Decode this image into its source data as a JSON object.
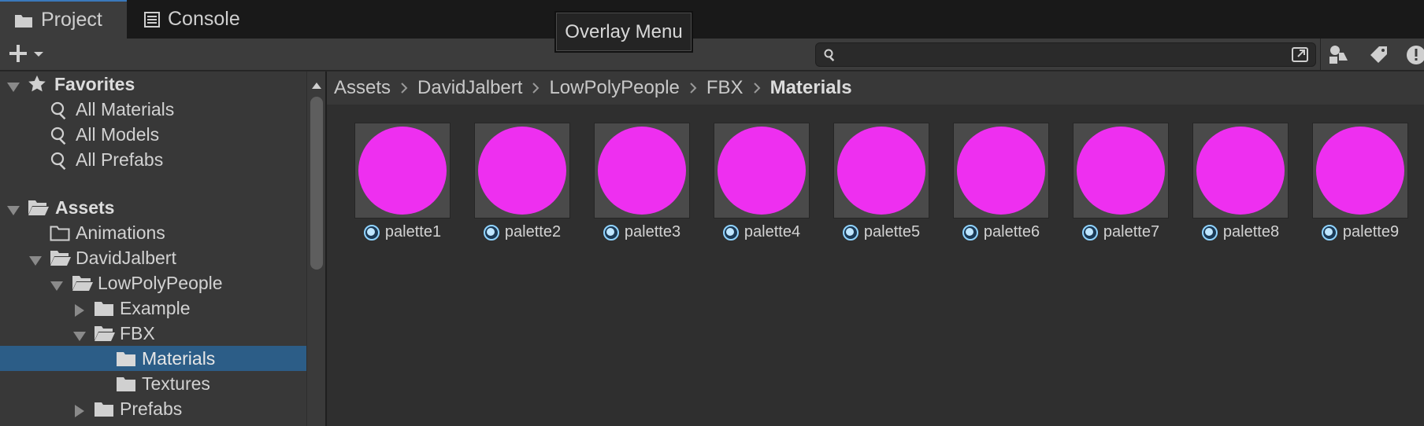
{
  "tabs": [
    {
      "label": "Project",
      "icon": "folder-icon",
      "active": true
    },
    {
      "label": "Console",
      "icon": "console-icon",
      "active": false
    }
  ],
  "overlay_menu": {
    "label": "Overlay Menu"
  },
  "toolbar": {
    "add_icon": "plus-icon",
    "search": {
      "value": "",
      "placeholder": ""
    },
    "right_icons": [
      "search-by-type-icon",
      "search-by-label-icon",
      "warning-filter-icon"
    ]
  },
  "tree": {
    "favorites": {
      "label": "Favorites",
      "items": [
        "All Materials",
        "All Models",
        "All Prefabs"
      ]
    },
    "assets": {
      "label": "Assets",
      "children": {
        "animations": "Animations",
        "davidjalbert": "DavidJalbert",
        "lowpolypeople": "LowPolyPeople",
        "example": "Example",
        "fbx": "FBX",
        "materials": "Materials",
        "textures": "Textures",
        "prefabs": "Prefabs"
      }
    }
  },
  "breadcrumb": [
    "Assets",
    "DavidJalbert",
    "LowPolyPeople",
    "FBX",
    "Materials"
  ],
  "assets_grid": [
    {
      "name": "palette1"
    },
    {
      "name": "palette2"
    },
    {
      "name": "palette3"
    },
    {
      "name": "palette4"
    },
    {
      "name": "palette5"
    },
    {
      "name": "palette6"
    },
    {
      "name": "palette7"
    },
    {
      "name": "palette8"
    },
    {
      "name": "palette9"
    }
  ],
  "colors": {
    "material_preview": "#ee2ff0",
    "selection": "#2c5d87",
    "tab_accent": "#3a79bb"
  }
}
